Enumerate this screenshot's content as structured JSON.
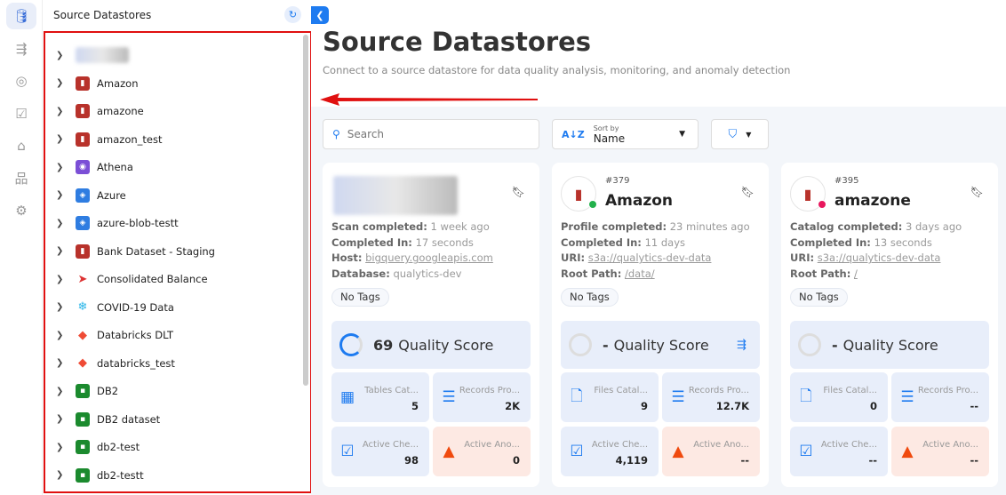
{
  "rail": {
    "items": [
      {
        "icon": "database-icon",
        "active": true
      },
      {
        "icon": "datastore-flow-icon"
      },
      {
        "icon": "compass-icon"
      },
      {
        "icon": "clipboard-check-icon"
      },
      {
        "icon": "tag-icon"
      },
      {
        "icon": "hierarchy-icon"
      },
      {
        "icon": "gear-icon"
      }
    ]
  },
  "tree": {
    "title": "Source Datastores",
    "items": [
      {
        "label": "",
        "icon": "blurred-logo"
      },
      {
        "label": "Amazon",
        "icon": "aws-s3-icon"
      },
      {
        "label": "amazone",
        "icon": "aws-s3-icon"
      },
      {
        "label": "amazon_test",
        "icon": "aws-s3-icon"
      },
      {
        "label": "Athena",
        "icon": "athena-icon"
      },
      {
        "label": "Azure",
        "icon": "azure-icon"
      },
      {
        "label": "azure-blob-testt",
        "icon": "azure-icon"
      },
      {
        "label": "Bank Dataset - Staging",
        "icon": "aws-s3-icon"
      },
      {
        "label": "Consolidated Balance",
        "icon": "redshift-icon"
      },
      {
        "label": "COVID-19 Data",
        "icon": "snowflake-icon"
      },
      {
        "label": "Databricks DLT",
        "icon": "databricks-icon"
      },
      {
        "label": "databricks_test",
        "icon": "databricks-icon"
      },
      {
        "label": "DB2",
        "icon": "ibm-db2-icon"
      },
      {
        "label": "DB2 dataset",
        "icon": "ibm-db2-icon"
      },
      {
        "label": "db2-test",
        "icon": "ibm-db2-icon"
      },
      {
        "label": "db2-testt",
        "icon": "ibm-db2-icon"
      }
    ]
  },
  "main": {
    "title": "Source Datastores",
    "subtitle": "Connect to a source datastore for data quality analysis, monitoring, and anomaly detection",
    "search": {
      "placeholder": "Search"
    },
    "sort": {
      "label": "Sort by",
      "value": "Name"
    },
    "cards": [
      {
        "number": "",
        "name": "",
        "status_color": "",
        "meta": [
          {
            "k": "Scan completed:",
            "v": "1 week ago"
          },
          {
            "k": "Completed In:",
            "v": "17 seconds"
          },
          {
            "k": "Host:",
            "v": "bigquery.googleapis.com",
            "link": true
          },
          {
            "k": "Database:",
            "v": "qualytics-dev"
          }
        ],
        "tags": "No Tags",
        "score": "69",
        "score_label": "Quality Score",
        "score_pct": 69,
        "stats": [
          {
            "label": "Tables Cat...",
            "value": "5",
            "icon": "table-icon"
          },
          {
            "label": "Records Pro...",
            "value": "2K",
            "icon": "records-icon"
          },
          {
            "label": "Active Che...",
            "value": "98",
            "icon": "check-icon"
          },
          {
            "label": "Active Ano...",
            "value": "0",
            "icon": "warning-icon"
          }
        ]
      },
      {
        "number": "#379",
        "name": "Amazon",
        "status_color": "#22b14c",
        "meta": [
          {
            "k": "Profile completed:",
            "v": "23 minutes ago"
          },
          {
            "k": "Completed In:",
            "v": "11 days"
          },
          {
            "k": "URI:",
            "v": "s3a://qualytics-dev-data",
            "link": true
          },
          {
            "k": "Root Path:",
            "v": "/data/",
            "link": true
          }
        ],
        "tags": "No Tags",
        "score": "-",
        "score_label": "Quality Score",
        "enrichment": true,
        "stats": [
          {
            "label": "Files Catal...",
            "value": "9",
            "icon": "file-icon"
          },
          {
            "label": "Records Pro...",
            "value": "12.7K",
            "icon": "records-icon"
          },
          {
            "label": "Active Che...",
            "value": "4,119",
            "icon": "check-icon"
          },
          {
            "label": "Active Ano...",
            "value": "--",
            "icon": "warning-icon"
          }
        ]
      },
      {
        "number": "#395",
        "name": "amazone",
        "status_color": "#e8175d",
        "meta": [
          {
            "k": "Catalog completed:",
            "v": "3 days ago"
          },
          {
            "k": "Completed In:",
            "v": "13 seconds"
          },
          {
            "k": "URI:",
            "v": "s3a://qualytics-dev-data",
            "link": true
          },
          {
            "k": "Root Path:",
            "v": "/",
            "link": true
          }
        ],
        "tags": "No Tags",
        "score": "-",
        "score_label": "Quality Score",
        "stats": [
          {
            "label": "Files Catal...",
            "value": "0",
            "icon": "file-icon"
          },
          {
            "label": "Records Pro...",
            "value": "--",
            "icon": "records-icon"
          },
          {
            "label": "Active Che...",
            "value": "--",
            "icon": "check-icon"
          },
          {
            "label": "Active Ano...",
            "value": "--",
            "icon": "warning-icon"
          }
        ]
      }
    ]
  }
}
